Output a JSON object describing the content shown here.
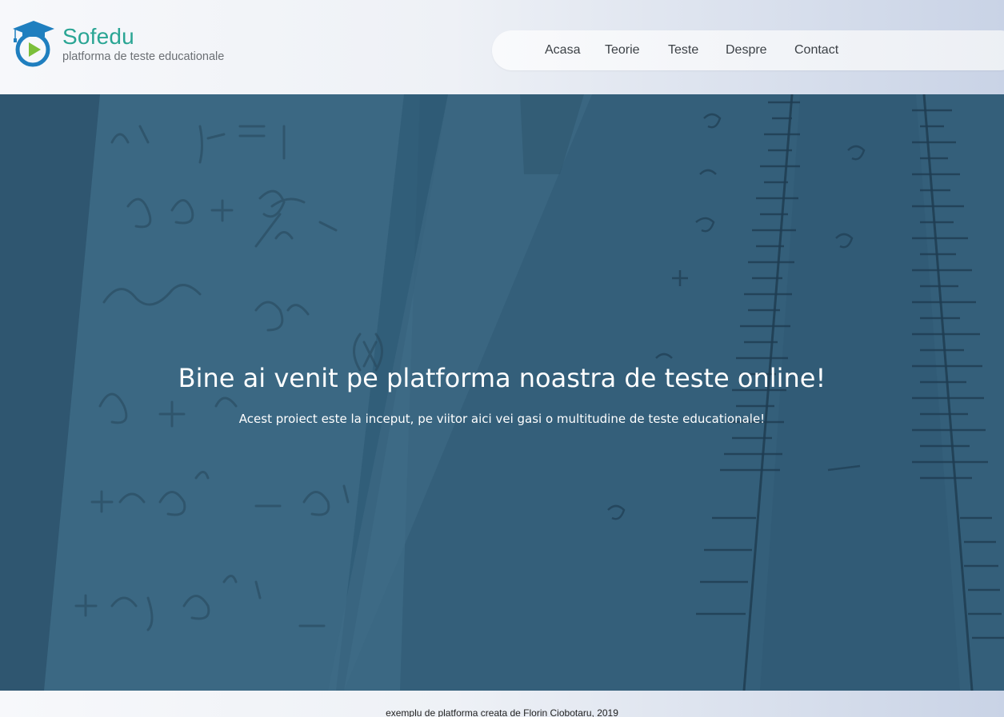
{
  "brand": {
    "name": "Sofedu",
    "tagline": "platforma de teste educationale",
    "colors": {
      "accent": "#2aa594",
      "cap": "#1f7fbf",
      "play": "#7bbf3a"
    },
    "icon": "graduation-cap-play-icon"
  },
  "nav": {
    "items": [
      {
        "label": "Acasa"
      },
      {
        "label": "Teorie"
      },
      {
        "label": "Teste"
      },
      {
        "label": "Despre"
      },
      {
        "label": "Contact"
      }
    ]
  },
  "hero": {
    "title": "Bine ai venit pe platforma noastra de teste online!",
    "subtitle": "Acest proiect este la inceput, pe viitor aici vei gasi o multitudine de teste educationale!",
    "overlay_color": "#345f7a"
  },
  "footer": {
    "text": "exemplu de platforma creata de Florin Ciobotaru, 2019"
  }
}
